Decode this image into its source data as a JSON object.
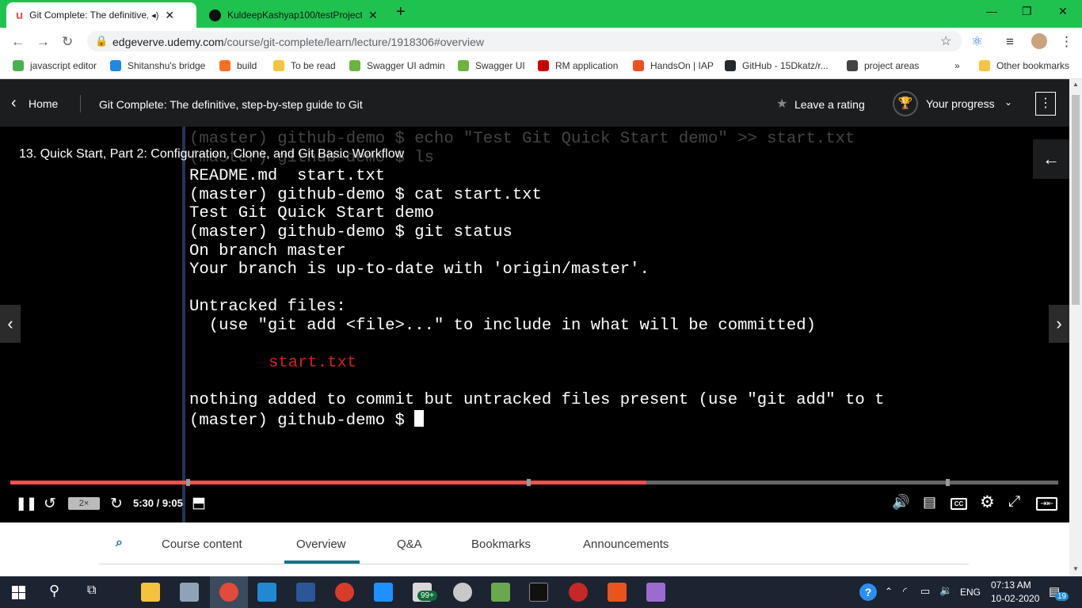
{
  "browser": {
    "tabs": [
      {
        "title": "Git Complete: The definitive,",
        "icon": "udemy-icon",
        "active": true
      },
      {
        "title": "KuldeepKashyap100/testProject:",
        "icon": "github-icon",
        "active": false
      }
    ],
    "new_tab": "+",
    "url_domain": "edgeverve.udemy.com",
    "url_path": "/course/git-complete/learn/lecture/1918306#overview"
  },
  "bookmarks": {
    "items": [
      {
        "label": "javascript editor",
        "color": "#4caf50"
      },
      {
        "label": "Shitanshu's bridge",
        "color": "#1e88e5"
      },
      {
        "label": "build",
        "color": "#fc6d26"
      },
      {
        "label": "To be read",
        "color": "#f5c542"
      },
      {
        "label": "Swagger UI admin",
        "color": "#6db33f"
      },
      {
        "label": "Swagger UI",
        "color": "#6db33f"
      },
      {
        "label": "RM application",
        "color": "#cc0000"
      },
      {
        "label": "HandsOn | IAP",
        "color": "#f25022"
      },
      {
        "label": "GitHub - 15Dkatz/r...",
        "color": "#24292e"
      },
      {
        "label": "project areas",
        "color": "#444444"
      }
    ],
    "overflow": "»",
    "other": "Other bookmarks"
  },
  "header": {
    "home": "Home",
    "course_title": "Git Complete: The definitive, step-by-step guide to Git",
    "rating": "Leave a rating",
    "progress": "Your progress"
  },
  "video": {
    "lecture_title": "13. Quick Start, Part 2: Configuration, Clone, and Git Basic Workflow",
    "terminal": {
      "line1": "(master) github-demo $ echo \"Test Git Quick Start demo\" >> start.txt",
      "line2": "(master) github-demo $ ls",
      "line3": "README.md  start.txt",
      "line4": "(master) github-demo $ cat start.txt",
      "line5": "Test Git Quick Start demo",
      "line6": "(master) github-demo $ git status",
      "line7": "On branch master",
      "line8": "Your branch is up-to-date with 'origin/master'.",
      "line9": "Untracked files:",
      "line10": "  (use \"git add <file>...\" to include in what will be committed)",
      "line11": "\tstart.txt",
      "line12": "nothing added to commit but untracked files present (use \"git add\" to t",
      "line13": "(master) github-demo $ "
    },
    "progress_fraction": 0.607,
    "speed": "2×",
    "time": "5:30 / 9:05",
    "accent_color": "#ec5252"
  },
  "course_tabs": {
    "items": [
      "Course content",
      "Overview",
      "Q&A",
      "Bookmarks",
      "Announcements"
    ],
    "active": "Overview"
  },
  "taskbar": {
    "language": "ENG",
    "time": "07:13 AM",
    "date": "10-02-2020",
    "notifications": "19",
    "badge": "99+"
  }
}
